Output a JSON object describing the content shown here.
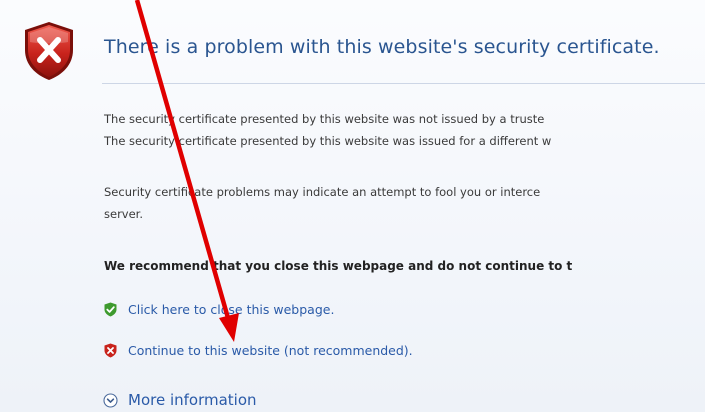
{
  "error_page": {
    "title": "There is a problem with this website's security certificate.",
    "para1_line1": "The security certificate presented by this website was not issued by a truste",
    "para1_line2": "The security certificate presented by this website was issued for a different w",
    "para2_line1": "Security certificate problems may indicate an attempt to fool you or interce",
    "para2_line2": "server.",
    "recommendation": "We recommend that you close this webpage and do not continue to t"
  },
  "options": {
    "close_label": "Click here to close this webpage.",
    "continue_label": "Continue to this website (not recommended).",
    "more_info_label": "More information"
  },
  "icons": {
    "shield": "shield-error-icon",
    "close_option": "green-check-shield-icon",
    "continue_option": "red-x-shield-icon",
    "more_info": "expand-chevron-icon"
  },
  "colors": {
    "title": "#2a5590",
    "link": "#2a5aa8",
    "shield_red": "#c8231c",
    "check_green": "#3e9a2e",
    "annotation_arrow": "#e00000"
  }
}
